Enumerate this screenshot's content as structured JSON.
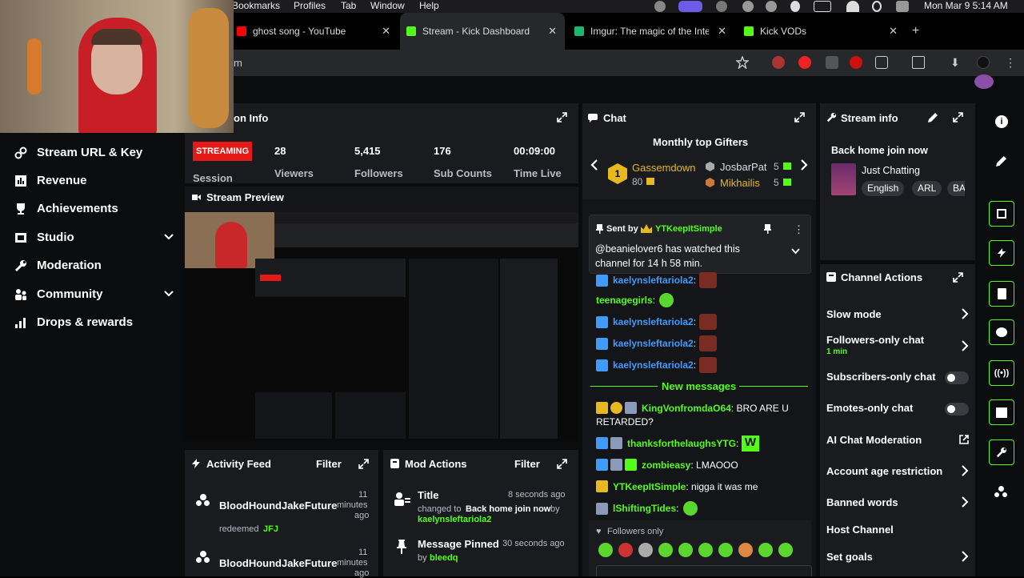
{
  "menubar": {
    "items": [
      "Bookmarks",
      "Profiles",
      "Tab",
      "Window",
      "Help"
    ],
    "clock": "Mon Mar 9  5:14 AM"
  },
  "tabs": [
    {
      "title": "ghost song - YouTube",
      "icon": "youtube-icon",
      "color": "#ff0000"
    },
    {
      "title": "Stream - Kick Dashboard",
      "icon": "kick-icon",
      "color": "#53fc18"
    },
    {
      "title": "Imgur: The magic of the Internet",
      "icon": "imgur-icon",
      "color": "#1bb76e"
    },
    {
      "title": "Kick VODs",
      "icon": "kick-icon",
      "color": "#53fc18"
    }
  ],
  "address": {
    "url": "m"
  },
  "sidebar": {
    "items": [
      {
        "label": "Stream URL & Key",
        "icon": "link-icon"
      },
      {
        "label": "Revenue",
        "icon": "chart-icon"
      },
      {
        "label": "Achievements",
        "icon": "trophy-icon"
      },
      {
        "label": "Studio",
        "icon": "film-icon",
        "chevron": true
      },
      {
        "label": "Moderation",
        "icon": "wrench-icon"
      },
      {
        "label": "Community",
        "icon": "people-icon",
        "chevron": true
      },
      {
        "label": "Drops & rewards",
        "icon": "gift-icon"
      }
    ]
  },
  "session": {
    "title": "on Info",
    "status": "STREAMING",
    "status_label": "Session",
    "stats": [
      {
        "value": "28",
        "label": "Viewers"
      },
      {
        "value": "5,415",
        "label": "Followers"
      },
      {
        "value": "176",
        "label": "Sub Counts"
      },
      {
        "value": "00:09:00",
        "label": "Time Live"
      }
    ]
  },
  "preview": {
    "title": "Stream Preview"
  },
  "activity": {
    "title": "Activity Feed",
    "filter": "Filter",
    "items": [
      {
        "user": "BloodHoundJakeFuture",
        "time1": "11",
        "time2": "minutes",
        "time3": "ago",
        "action": "redeemed",
        "reward": "JFJ"
      },
      {
        "user": "BloodHoundJakeFuture",
        "time1": "11",
        "time2": "minutes",
        "time3": "ago"
      }
    ]
  },
  "modactions": {
    "title": "Mod Actions",
    "filter": "Filter",
    "items": [
      {
        "title": "Title",
        "time": "8 seconds ago",
        "line1a": "changed to",
        "line1b": "Back home join now",
        "line1c": "by",
        "user": "kaelynsleftariola2"
      },
      {
        "title": "Message Pinned",
        "time": "30 seconds ago",
        "by": "by",
        "user": "bleedq"
      }
    ]
  },
  "chat": {
    "title": "Chat",
    "gifters_title": "Monthly top Gifters",
    "gifters": [
      {
        "name": "Gassemdown",
        "count": "80",
        "rank": "1"
      },
      {
        "name": "JosbarPat",
        "count": "5"
      },
      {
        "name": "Mikhailis",
        "count": "5"
      }
    ],
    "pinned": {
      "sent_by": "Sent by",
      "user": "YTKeepItSimple",
      "message": "@beanielover6 has watched this channel for 14 h 58 min."
    },
    "lines": [
      {
        "user": "kaelynsleftariola2",
        "color": "#3f9bff",
        "text": ":",
        "emote": "avatar"
      },
      {
        "user": "teenagegirls",
        "color": "#53fc18",
        "text": ":",
        "emote": "frog"
      },
      {
        "user": "kaelynsleftariola2",
        "color": "#3f9bff",
        "text": ":",
        "emote": "avatar"
      },
      {
        "user": "kaelynsleftariola2",
        "color": "#3f9bff",
        "text": ":",
        "emote": "avatar"
      },
      {
        "user": "kaelynsleftariola2",
        "color": "#3f9bff",
        "text": ":",
        "emote": "avatar"
      }
    ],
    "new_messages": "New messages",
    "messages": [
      {
        "user": "KingVonfromdaO64",
        "color": "#53fc18",
        "text": ": BRO ARE U",
        "text2": "RETARDED?"
      },
      {
        "user": "thanksforthelaughsYTG",
        "color": "#53fc18",
        "text": ":"
      },
      {
        "user": "zombieasy",
        "color": "#53fc18",
        "text": ": LMAOOO"
      },
      {
        "user": "YTKeepItSimple",
        "color": "#53fc18",
        "text": ": nigga it was me"
      },
      {
        "user": "lShiftingTides",
        "color": "#53fc18",
        "text": ":"
      }
    ],
    "followers_only": "Followers only"
  },
  "streaminfo": {
    "title": "Stream info",
    "stream_title": "Back home join now",
    "category": "Just Chatting",
    "tags": [
      "English",
      "ARL",
      "BA"
    ]
  },
  "channel_actions": {
    "title": "Channel Actions",
    "items": [
      {
        "label": "Slow mode",
        "type": "chevron"
      },
      {
        "label": "Followers-only chat",
        "sub": "1 min",
        "type": "chevron"
      },
      {
        "label": "Subscribers-only chat",
        "type": "toggle"
      },
      {
        "label": "Emotes-only chat",
        "type": "toggle"
      },
      {
        "label": "AI Chat Moderation",
        "type": "external"
      },
      {
        "label": "Account age restriction",
        "type": "chevron"
      },
      {
        "label": "Banned words",
        "type": "chevron"
      },
      {
        "label": "Host Channel",
        "type": "none"
      },
      {
        "label": "Set goals",
        "type": "chevron"
      }
    ]
  },
  "colors": {
    "accent": "#53fc18",
    "panel": "#191b1f",
    "bg": "#0b0c0e",
    "streaming": "#e61919"
  }
}
